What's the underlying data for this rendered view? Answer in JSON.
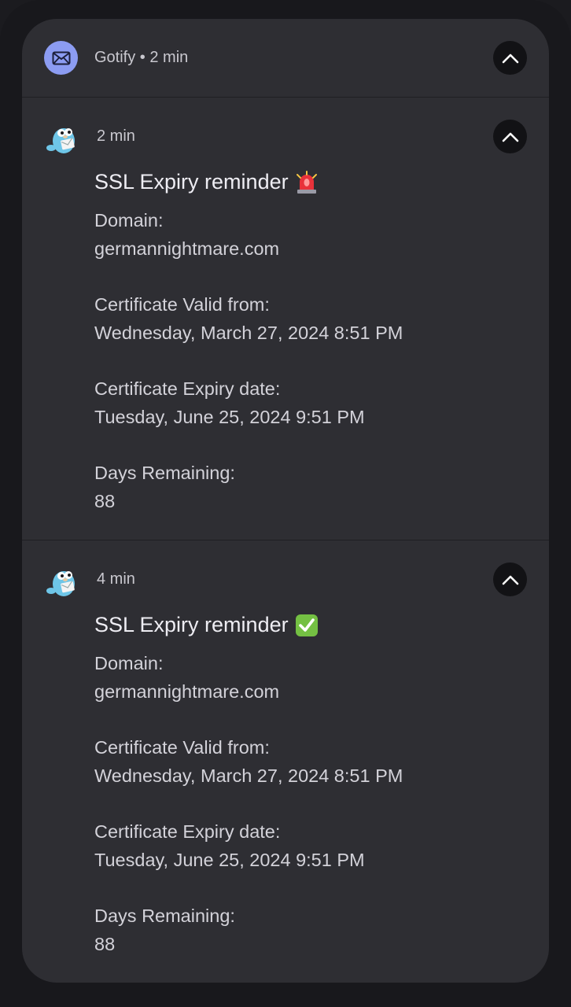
{
  "app": {
    "header": "Gotify • 2 min",
    "icon": "envelope-icon",
    "accent_color": "#8c9cf2"
  },
  "messages": [
    {
      "time": "2 min",
      "title": "SSL Expiry reminder",
      "emoji": "rotating-light-icon",
      "body": "Domain:\ngermannightmare.com\n\nCertificate Valid from:\nWednesday, March 27, 2024 8:51 PM\n\nCertificate Expiry date:\nTuesday, June 25, 2024 9:51 PM\n\nDays Remaining:\n88"
    },
    {
      "time": "4 min",
      "title": "SSL Expiry reminder",
      "emoji": "check-mark-button-icon",
      "body": "Domain:\ngermannightmare.com\n\nCertificate Valid from:\nWednesday, March 27, 2024 8:51 PM\n\nCertificate Expiry date:\nTuesday, June 25, 2024 9:51 PM\n\nDays Remaining:\n88"
    }
  ]
}
